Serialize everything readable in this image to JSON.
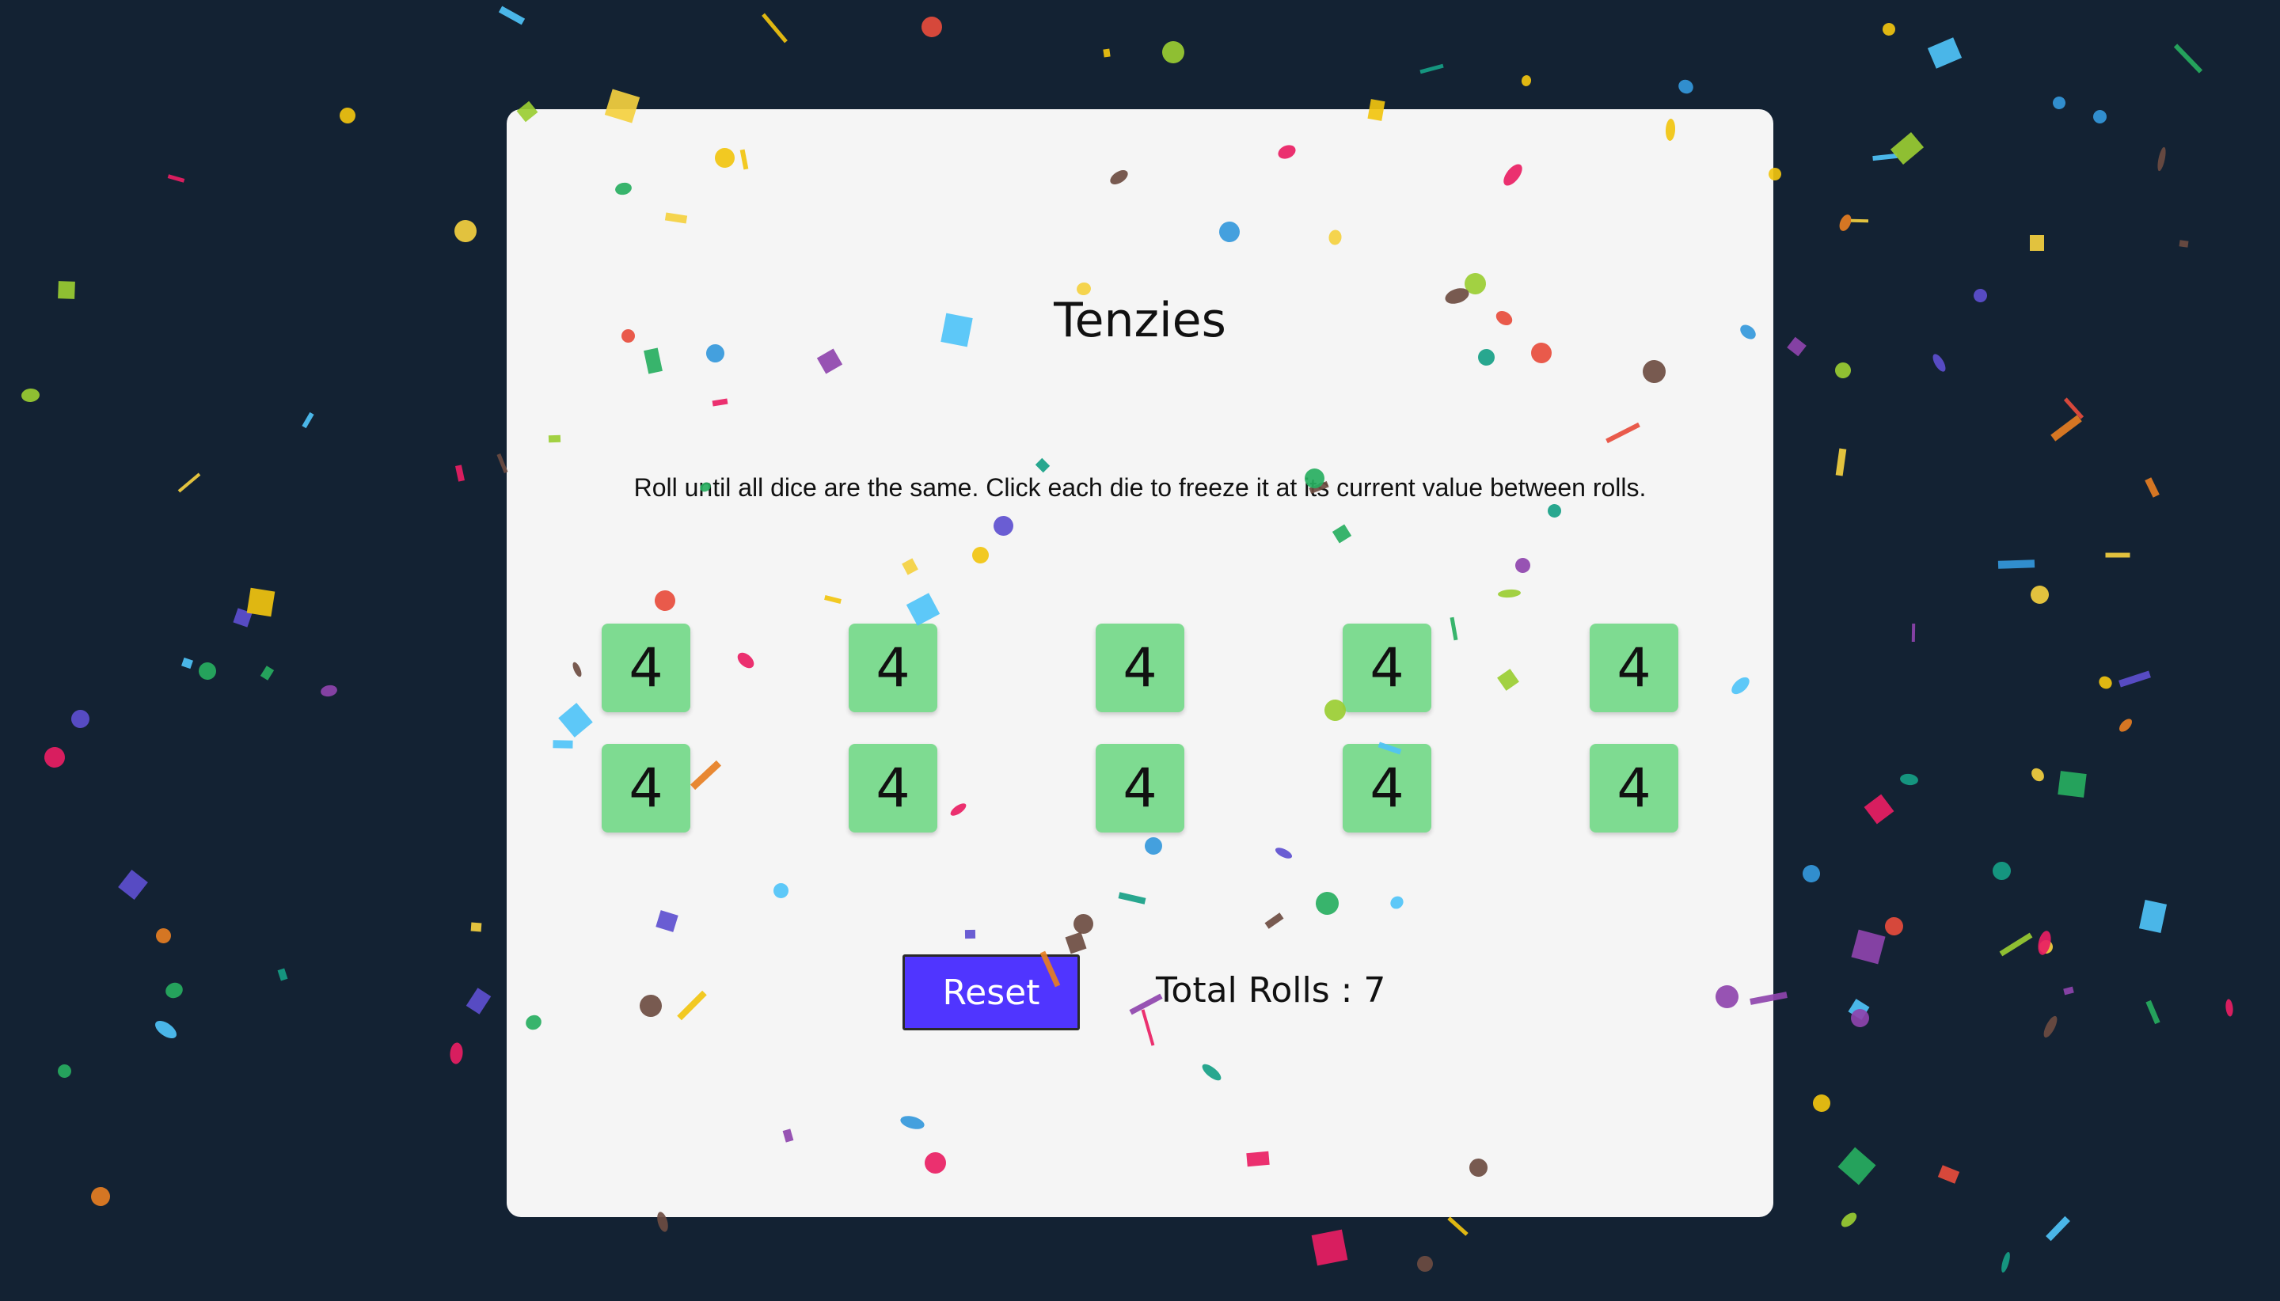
{
  "game": {
    "title": "Tenzies",
    "instructions": "Roll until all dice are the same. Click each die to freeze it at its current value between rolls.",
    "dice": [
      "4",
      "4",
      "4",
      "4",
      "4",
      "4",
      "4",
      "4",
      "4",
      "4"
    ],
    "reset_label": "Reset",
    "total_rolls_text": "Total Rolls : 7"
  },
  "theme": {
    "page_background": "#132233",
    "card_background": "#f5f5f5",
    "die_color": "#7edb91",
    "button_color": "#5035ff"
  },
  "confetti_colors": [
    "#f4d03f",
    "#e74c3c",
    "#e67e22",
    "#3498db",
    "#8e44ad",
    "#27ae60",
    "#9acd32",
    "#f1c40f",
    "#6d4c41",
    "#16a085",
    "#e91e63",
    "#5d4fcf",
    "#4fc3f7"
  ]
}
